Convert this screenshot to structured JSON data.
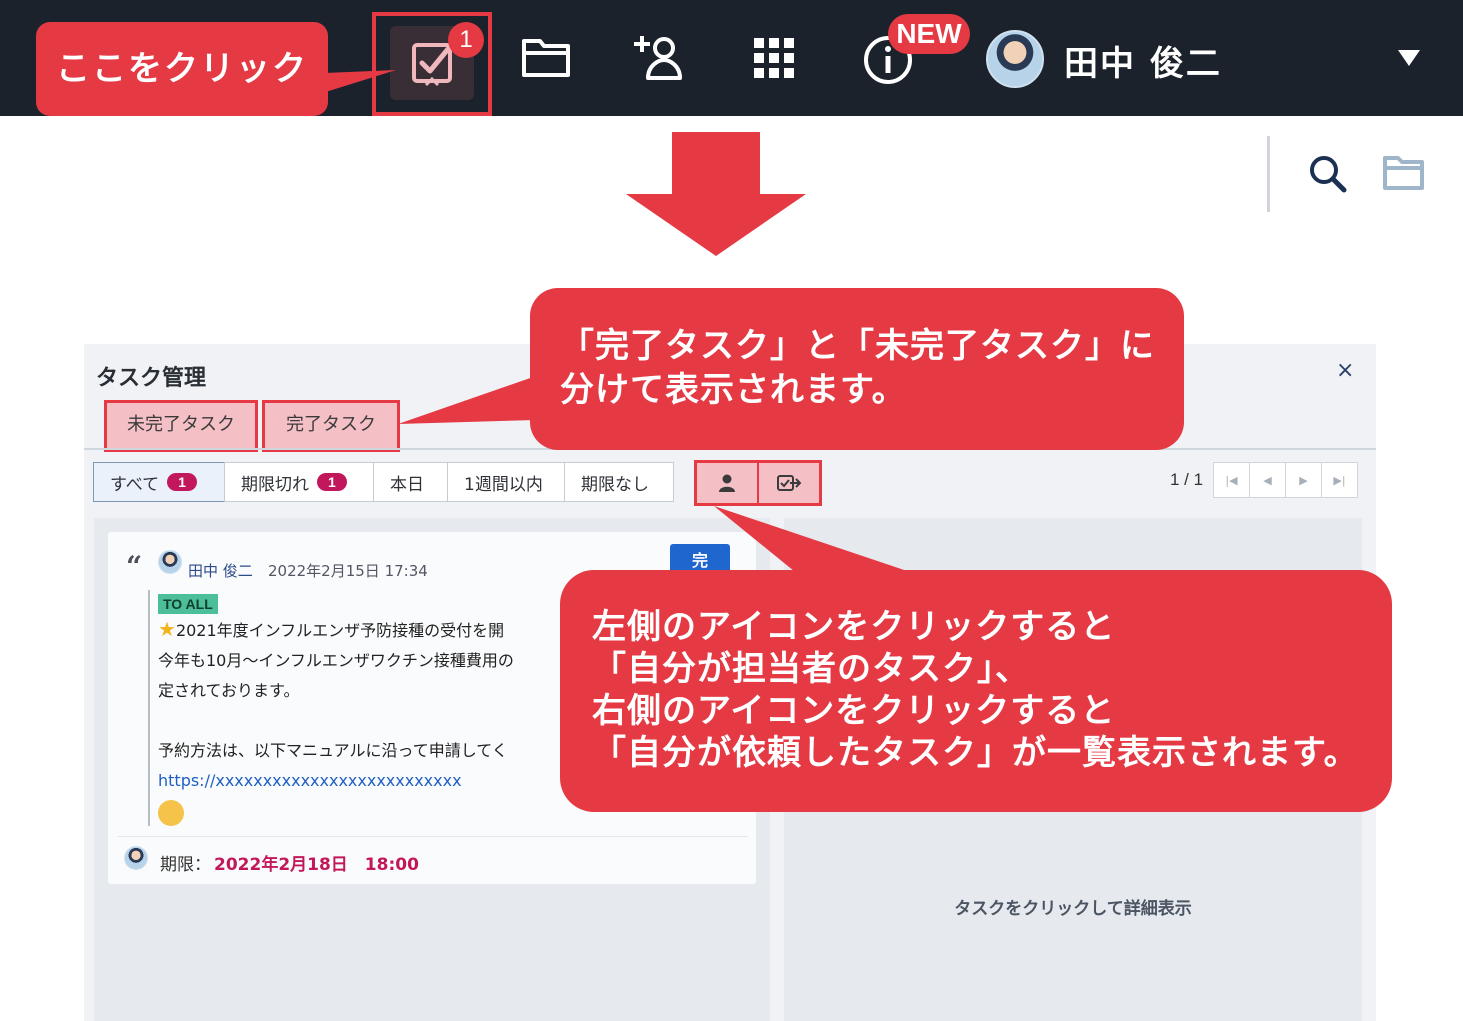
{
  "nav": {
    "task_badge_count": "1",
    "new_badge": "NEW",
    "user_name": "田中 俊二"
  },
  "callouts": {
    "click_here": "ここをクリック",
    "tabs_note": [
      "「完了タスク」と「未完了タスク」に",
      "分けて表示されます。"
    ],
    "icons_note": [
      "左側のアイコンをクリックすると",
      "「自分が担当者のタスク」、",
      "右側のアイコンをクリックすると",
      "「自分が依頼したタスク」が一覧表示されます。"
    ]
  },
  "panel": {
    "title": "タスク管理",
    "close": "×",
    "tabs": [
      "未完了タスク",
      "完了タスク"
    ],
    "filters": [
      {
        "label": "すべて",
        "count": "1"
      },
      {
        "label": "期限切れ",
        "count": "1"
      },
      {
        "label": "本日"
      },
      {
        "label": "1週間以内"
      },
      {
        "label": "期限なし"
      }
    ],
    "page_indicator": "1 / 1",
    "pager_buttons": [
      "|◀",
      "◀",
      "▶",
      "▶|"
    ],
    "detail_hint": "タスクをクリックして詳細表示"
  },
  "task_card": {
    "author": "田中 俊二",
    "timestamp": "2022年2月15日 17:34",
    "complete_button": "完",
    "tag": "TO ALL",
    "lines": [
      "2021年度インフルエンザ予防接種の受付を開",
      "今年も10月〜インフルエンザワクチン接種費用の",
      "定されております。",
      "",
      "予約方法は、以下マニュアルに沿って申請してく"
    ],
    "link": "https://xxxxxxxxxxxxxxxxxxxxxxxxxx",
    "deadline_label": "期限：",
    "deadline_value": "2022年2月18日　18:00"
  },
  "colors": {
    "accent": "#e53a44",
    "nav_bg": "#1b222c",
    "badge_magenta": "#c2185b",
    "primary_blue": "#1f66cf"
  }
}
